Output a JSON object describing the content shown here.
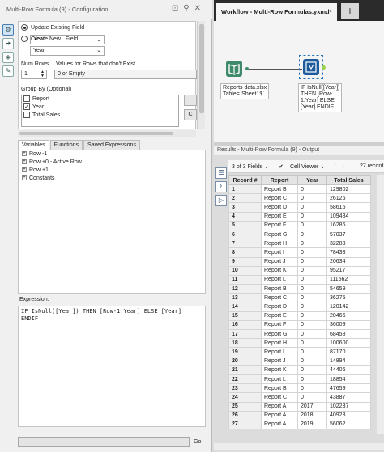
{
  "config": {
    "title": "Multi-Row Formula (9) - Configuration",
    "update_existing_label": "Update Existing Field",
    "create_new_label": "Create New",
    "field_label": "Field",
    "field_value": "Year",
    "num_rows_label": "Num Rows",
    "num_rows_value": "1",
    "values_for_rows_label": "Values for Rows that don't Exist",
    "values_for_rows_value": "0 or Empty",
    "group_by_label": "Group By (Optional)",
    "group_by_fields": [
      {
        "label": "Report",
        "checked": false
      },
      {
        "label": "Year",
        "checked": true
      },
      {
        "label": "Total Sales",
        "checked": false
      }
    ],
    "side_button_c": "C",
    "tabs": [
      "Variables",
      "Functions",
      "Saved Expressions"
    ],
    "variables_tree": [
      "Row -1",
      "Row +0 - Active Row",
      "Row +1",
      "Constants"
    ],
    "expression_label": "Expression:",
    "expression_text": "IF IsNull([Year]) THEN [Row-1:Year] ELSE [Year]\nENDIF",
    "go_label": "Go"
  },
  "workflow": {
    "tab_title": "Workflow - Multi-Row Formulas.yxmd*",
    "plus_label": "+",
    "input_tool_label": "Reports data.xlsx\nTable=`Sheet1$`",
    "formula_tool_label": "IF IsNull([Year])\nTHEN [Row-\n1:Year] ELSE\n[Year] ENDIF"
  },
  "results": {
    "header": "Results - Multi-Row Formula (9) - Output",
    "fields_label": "3 of 3 Fields",
    "cell_viewer_label": "Cell Viewer",
    "records_label": "27 record",
    "columns": [
      "Record #",
      "Report",
      "Year",
      "Total Sales"
    ],
    "rows": [
      [
        "1",
        "Report B",
        "0",
        "129802"
      ],
      [
        "2",
        "Report C",
        "0",
        "26126"
      ],
      [
        "3",
        "Report D",
        "0",
        "58615"
      ],
      [
        "4",
        "Report E",
        "0",
        "109484"
      ],
      [
        "5",
        "Report F",
        "0",
        "16286"
      ],
      [
        "6",
        "Report G",
        "0",
        "57037"
      ],
      [
        "7",
        "Report H",
        "0",
        "32283"
      ],
      [
        "8",
        "Report I",
        "0",
        "78433"
      ],
      [
        "9",
        "Report J",
        "0",
        "20634"
      ],
      [
        "10",
        "Report K",
        "0",
        "95217"
      ],
      [
        "11",
        "Report L",
        "0",
        "111562"
      ],
      [
        "12",
        "Report B",
        "0",
        "54659"
      ],
      [
        "13",
        "Report C",
        "0",
        "36275"
      ],
      [
        "14",
        "Report D",
        "0",
        "120142"
      ],
      [
        "15",
        "Report E",
        "0",
        "20466"
      ],
      [
        "16",
        "Report F",
        "0",
        "36009"
      ],
      [
        "17",
        "Report G",
        "0",
        "68458"
      ],
      [
        "18",
        "Report H",
        "0",
        "100600"
      ],
      [
        "19",
        "Report I",
        "0",
        "87170"
      ],
      [
        "20",
        "Report J",
        "0",
        "14894"
      ],
      [
        "21",
        "Report K",
        "0",
        "44406"
      ],
      [
        "22",
        "Report L",
        "0",
        "18854"
      ],
      [
        "23",
        "Report B",
        "0",
        "47659"
      ],
      [
        "24",
        "Report C",
        "0",
        "43887"
      ],
      [
        "25",
        "Report A",
        "2017",
        "102237"
      ],
      [
        "26",
        "Report A",
        "2018",
        "40923"
      ],
      [
        "27",
        "Report A",
        "2019",
        "56062"
      ]
    ]
  }
}
